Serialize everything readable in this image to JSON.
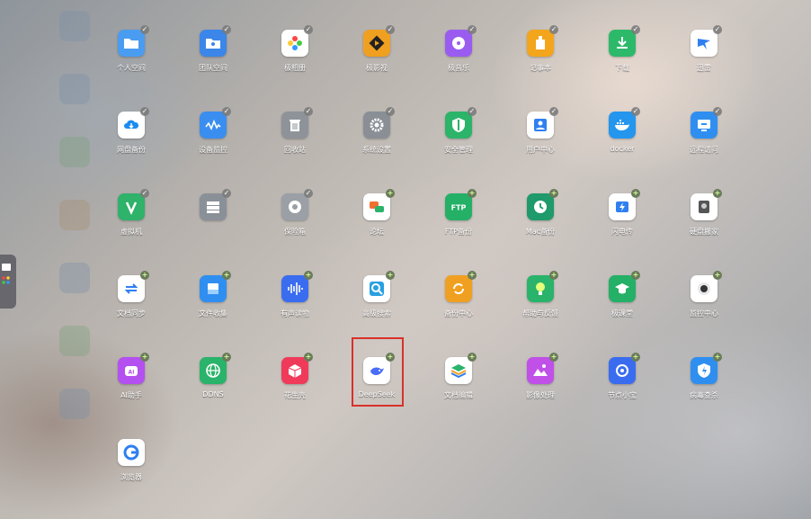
{
  "apps": [
    {
      "label": "个人空间",
      "icon": "folder-icon",
      "color": "#4a9cf0",
      "badge": "check"
    },
    {
      "label": "团队空间",
      "icon": "team-icon",
      "color": "#3b86e8",
      "badge": "check"
    },
    {
      "label": "极相册",
      "icon": "photos-icon",
      "color": "#ffffff",
      "badge": "check"
    },
    {
      "label": "极影视",
      "icon": "video-icon",
      "color": "#f0a020",
      "badge": "check"
    },
    {
      "label": "极音乐",
      "icon": "music-icon",
      "color": "#9a5cf0",
      "badge": "check"
    },
    {
      "label": "记事本",
      "icon": "notebook-icon",
      "color": "#f3a51c",
      "badge": "check"
    },
    {
      "label": "下载",
      "icon": "download-icon",
      "color": "#2db96a",
      "badge": "check"
    },
    {
      "label": "迅雷",
      "icon": "thunder-icon",
      "color": "#ffffff",
      "badge": "check"
    },
    {
      "label": "网盘备份",
      "icon": "cloud-icon",
      "color": "#ffffff",
      "badge": "check"
    },
    {
      "label": "设备监控",
      "icon": "monitor-wave-icon",
      "color": "#3a8ef0",
      "badge": "check"
    },
    {
      "label": "回收站",
      "icon": "trash-icon",
      "color": "#8e9399",
      "badge": "check"
    },
    {
      "label": "系统设置",
      "icon": "gear-icon",
      "color": "#8a8f96",
      "badge": "check"
    },
    {
      "label": "安全管理",
      "icon": "shield-icon",
      "color": "#2bb46a",
      "badge": "check"
    },
    {
      "label": "用户中心",
      "icon": "user-icon",
      "color": "#ffffff",
      "badge": "check"
    },
    {
      "label": "docker",
      "icon": "docker-icon",
      "color": "#2496ed",
      "badge": "check"
    },
    {
      "label": "远程访问",
      "icon": "remote-icon",
      "color": "#2f8ff0",
      "badge": "check"
    },
    {
      "label": "虚拟机",
      "icon": "vm-icon",
      "color": "#2fb26a",
      "badge": "check"
    },
    {
      "label": "",
      "icon": "storage-icon",
      "color": "#8a9098",
      "badge": "check"
    },
    {
      "label": "保险箱",
      "icon": "safe-icon",
      "color": "#9aa0a6",
      "badge": "check"
    },
    {
      "label": "论坛",
      "icon": "forum-icon",
      "color": "#ffffff",
      "badge": "add"
    },
    {
      "label": "FTP备份",
      "icon": "ftp-icon",
      "color": "#24b066",
      "badge": "add"
    },
    {
      "label": "Mac备份",
      "icon": "clock-icon",
      "color": "#1f9a6a",
      "badge": "add"
    },
    {
      "label": "闪电传",
      "icon": "flash-icon",
      "color": "#ffffff",
      "badge": "add"
    },
    {
      "label": "硬盘搬家",
      "icon": "disk-icon",
      "color": "#ffffff",
      "badge": "add"
    },
    {
      "label": "文档同步",
      "icon": "sync-icon",
      "color": "#ffffff",
      "badge": "add"
    },
    {
      "label": "文件收集",
      "icon": "file-collect-icon",
      "color": "#2f8ff0",
      "badge": "add"
    },
    {
      "label": "有声读物",
      "icon": "audio-wave-icon",
      "color": "#3a6cf0",
      "badge": "add"
    },
    {
      "label": "高级搜索",
      "icon": "search-icon",
      "color": "#ffffff",
      "badge": "add"
    },
    {
      "label": "备份中心",
      "icon": "backup-icon",
      "color": "#f0a020",
      "badge": "add"
    },
    {
      "label": "帮助与反馈",
      "icon": "bulb-icon",
      "color": "#2ab36a",
      "badge": "add"
    },
    {
      "label": "极课堂",
      "icon": "graduation-icon",
      "color": "#24b066",
      "badge": "add"
    },
    {
      "label": "监控中心",
      "icon": "camera-icon",
      "color": "#ffffff",
      "badge": "add"
    },
    {
      "label": "AI助手",
      "icon": "ai-icon",
      "color": "#b450f0",
      "badge": "add"
    },
    {
      "label": "DDNS",
      "icon": "globe-icon",
      "color": "#2ab36a",
      "badge": "add"
    },
    {
      "label": "花生壳",
      "icon": "cube-icon",
      "color": "#f03a5a",
      "badge": "add"
    },
    {
      "label": "DeepSeek",
      "icon": "whale-icon",
      "color": "#ffffff",
      "badge": "add"
    },
    {
      "label": "文档编辑",
      "icon": "layers-icon",
      "color": "#ffffff",
      "badge": "add"
    },
    {
      "label": "影像处理",
      "icon": "image-icon",
      "color": "#c050e8",
      "badge": "add"
    },
    {
      "label": "节点小宝",
      "icon": "node-icon",
      "color": "#3a6cf0",
      "badge": "add"
    },
    {
      "label": "病毒查杀",
      "icon": "antivirus-icon",
      "color": "#2f8ff0",
      "badge": "add"
    },
    {
      "label": "浏览器",
      "icon": "browser-icon",
      "color": "#ffffff",
      "badge": "none"
    }
  ]
}
